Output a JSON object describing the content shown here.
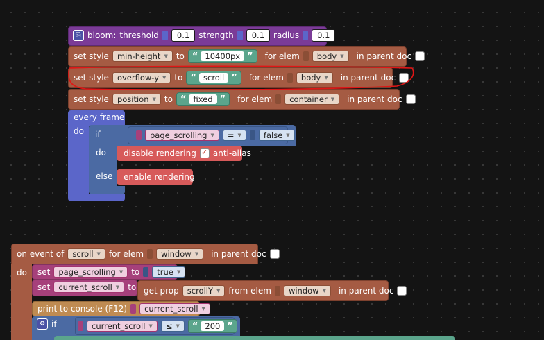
{
  "colors": {
    "purple": "#7b3b97",
    "brown": "#a55b43",
    "blue": "#4b6aa3",
    "violet": "#5b66c9",
    "pink": "#a6407b",
    "red": "#d75a5a",
    "green": "#5ba58c",
    "orange": "#bf8b52"
  },
  "bloom": {
    "label": "bloom:",
    "threshold_label": "threshold",
    "threshold": "0.1",
    "strength_label": "strength",
    "strength": "0.1",
    "radius_label": "radius",
    "radius": "0.1"
  },
  "style_rows": [
    {
      "set": "set style",
      "prop": "min-height",
      "to": "to",
      "value": "10400px",
      "for_elem": "for elem",
      "elem": "body",
      "in_parent": "in parent doc"
    },
    {
      "set": "set style",
      "prop": "overflow-y",
      "to": "to",
      "value": "scroll",
      "for_elem": "for elem",
      "elem": "body",
      "in_parent": "in parent doc"
    },
    {
      "set": "set style",
      "prop": "position",
      "to": "to",
      "value": "fixed",
      "for_elem": "for elem",
      "elem": "container",
      "in_parent": "in parent doc"
    }
  ],
  "every_frame": {
    "label": "every frame",
    "do": "do",
    "if": "if",
    "var": "page_scrolling",
    "op": "=",
    "value": "false",
    "do2": "do",
    "disable": "disable rendering",
    "anti_alias": "anti-alias",
    "else": "else",
    "enable": "enable rendering"
  },
  "event": {
    "on_event": "on event of",
    "event": "scroll",
    "for_elem": "for elem",
    "elem": "window",
    "in_parent": "in parent doc",
    "do": "do",
    "set1": {
      "set": "set",
      "var": "page_scrolling",
      "to": "to",
      "value": "true"
    },
    "set2": {
      "set": "set",
      "var": "current_scroll",
      "to": "to",
      "get_prop": "get prop",
      "prop": "scrollY",
      "from_elem": "from elem",
      "elem": "window",
      "in_parent": "in parent doc"
    },
    "print": {
      "label": "print to console (F12)",
      "var": "current_scroll"
    },
    "if": {
      "label": "if",
      "var": "current_scroll",
      "op": "≤",
      "value": "200"
    }
  }
}
